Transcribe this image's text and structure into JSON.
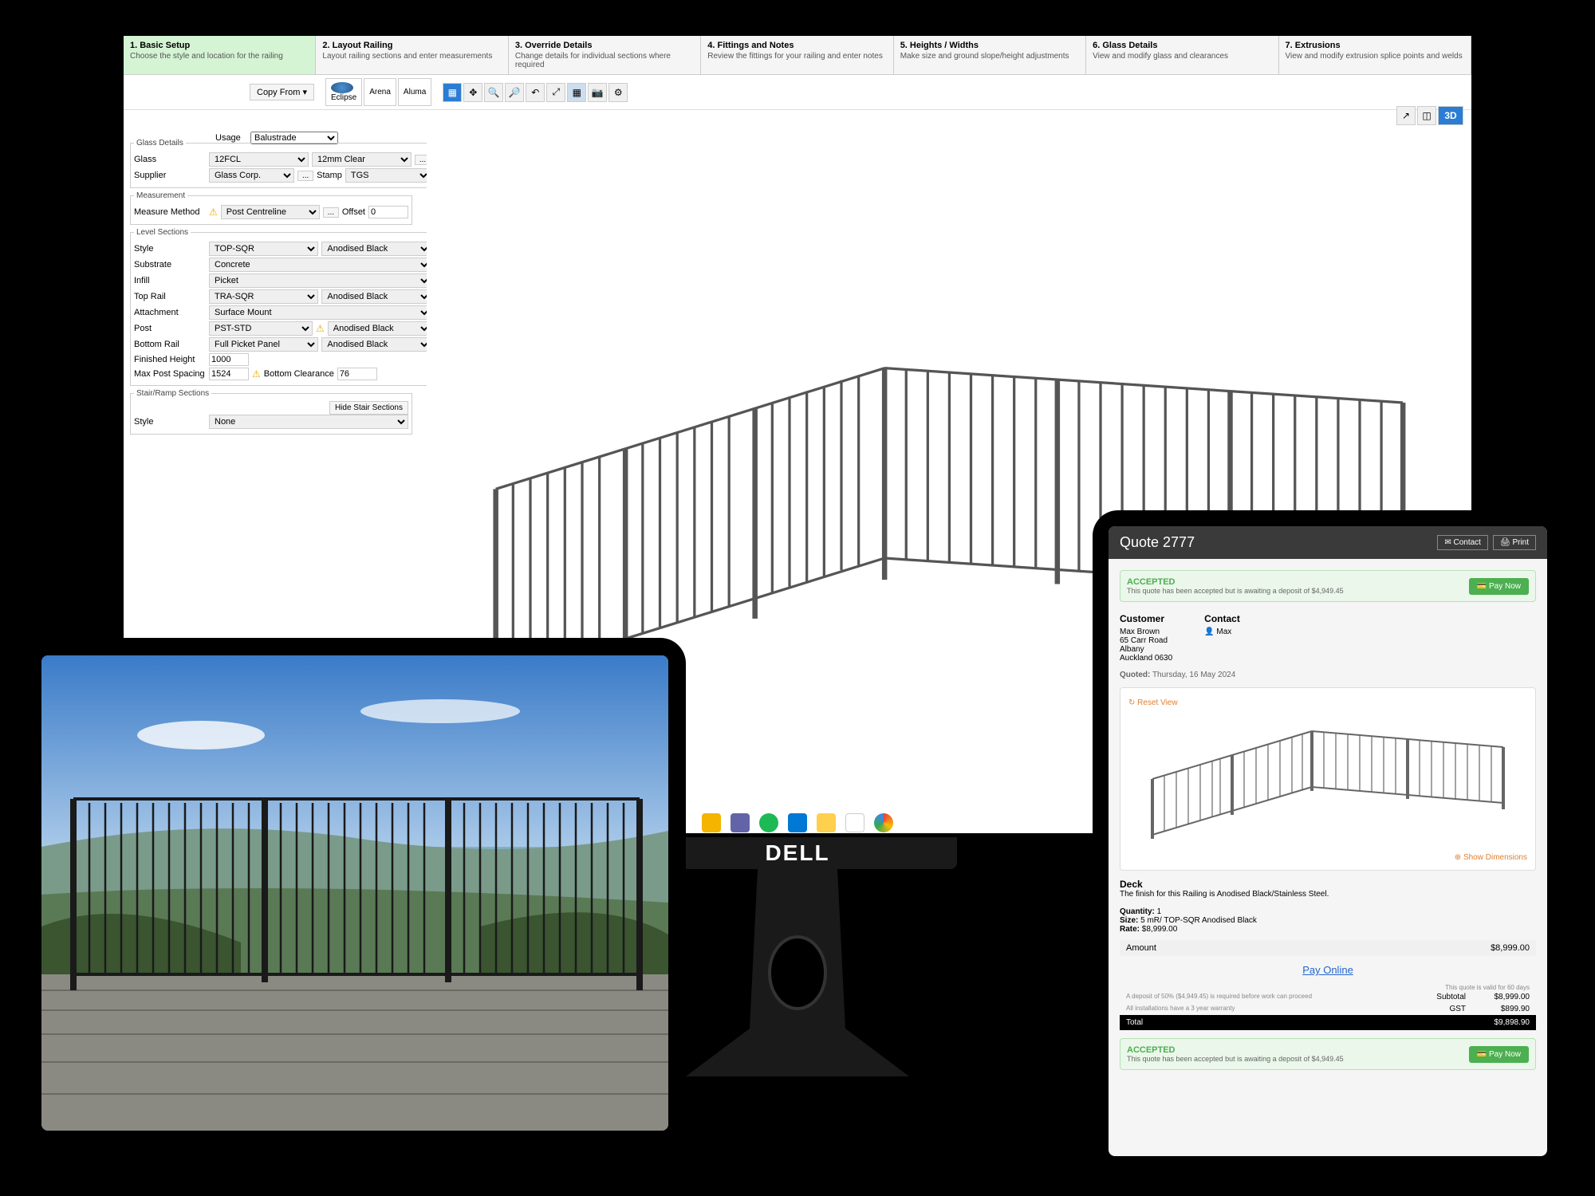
{
  "wizard": [
    {
      "title": "1. Basic Setup",
      "desc": "Choose the style and location for the railing",
      "active": true
    },
    {
      "title": "2. Layout Railing",
      "desc": "Layout railing sections and enter measurements"
    },
    {
      "title": "3. Override Details",
      "desc": "Change details for individual sections where required"
    },
    {
      "title": "4. Fittings and Notes",
      "desc": "Review the fittings for your railing and enter notes"
    },
    {
      "title": "5. Heights / Widths",
      "desc": "Make size and ground slope/height adjustments"
    },
    {
      "title": "6. Glass Details",
      "desc": "View and modify glass and clearances"
    },
    {
      "title": "7. Extrusions",
      "desc": "View and modify extrusion splice points and welds"
    }
  ],
  "toolbar": {
    "copy_from": "Copy From  ▾",
    "usage_label": "Usage",
    "usage_value": "Balustrade",
    "brands": [
      "Eclipse",
      "Arena",
      "Aluma"
    ],
    "view_3d": "3D"
  },
  "form": {
    "glass_details_title": "Glass Details",
    "glass_label": "Glass",
    "glass_code": "12FCL",
    "glass_type": "12mm Clear",
    "supplier_label": "Supplier",
    "supplier": "Glass Corp.",
    "stamp_label": "Stamp",
    "stamp": "TGS",
    "measurement_title": "Measurement",
    "measure_method_label": "Measure Method",
    "measure_method": "Post Centreline",
    "offset_label": "Offset",
    "offset": "0",
    "level_sections_title": "Level Sections",
    "style_label": "Style",
    "style_code": "TOP-SQR",
    "style_finish": "Anodised Black",
    "substrate_label": "Substrate",
    "substrate": "Concrete",
    "infill_label": "Infill",
    "infill": "Picket",
    "toprail_label": "Top Rail",
    "toprail_code": "TRA-SQR",
    "toprail_finish": "Anodised Black",
    "attachment_label": "Attachment",
    "attachment": "Surface Mount",
    "post_label": "Post",
    "post_code": "PST-STD",
    "post_finish": "Anodised Black",
    "bottomrail_label": "Bottom Rail",
    "bottomrail": "Full Picket Panel",
    "bottomrail_finish": "Anodised Black",
    "finished_height_label": "Finished Height",
    "finished_height": "1000",
    "max_post_label": "Max Post Spacing",
    "max_post": "1524",
    "bottom_clear_label": "Bottom Clearance",
    "bottom_clear": "76",
    "stair_title": "Stair/Ramp Sections",
    "hide_stair": "Hide Stair Sections",
    "stair_style_label": "Style",
    "stair_style": "None"
  },
  "quote": {
    "title": "Quote 2777",
    "contact_btn": "Contact",
    "print_btn": "Print",
    "accepted_title": "ACCEPTED",
    "accepted_desc": "This quote has been accepted but is awaiting a deposit of $4,949.45",
    "pay_now": "Pay Now",
    "customer_label": "Customer",
    "customer_name": "Max Brown",
    "customer_addr1": "65 Carr Road",
    "customer_addr2": "Albany",
    "customer_addr3": "Auckland 0630",
    "contact_label": "Contact",
    "contact_name": "Max",
    "quoted_label": "Quoted:",
    "quoted_date": "Thursday, 16 May 2024",
    "reset_view": "Reset View",
    "show_dimensions": "Show Dimensions",
    "deck_title": "Deck",
    "deck_desc": "The finish for this Railing is Anodised Black/Stainless Steel.",
    "quantity_label": "Quantity:",
    "quantity": "1",
    "size_label": "Size:",
    "size": "5 mR/ TOP-SQR Anodised Black",
    "rate_label": "Rate:",
    "rate": "$8,999.00",
    "amount_label": "Amount",
    "amount": "$8,999.00",
    "pay_online": "Pay Online",
    "validity": "This quote is valid for 60 days",
    "deposit_note": "A deposit of 50% ($4,949.45) is required before work can proceed",
    "warranty": "All installations have a 3 year warranty",
    "subtotal_label": "Subtotal",
    "subtotal": "$8,999.00",
    "gst_label": "GST",
    "gst": "$899.90",
    "total_label": "Total",
    "total": "$9,898.90"
  },
  "monitor_brand": "DELL"
}
